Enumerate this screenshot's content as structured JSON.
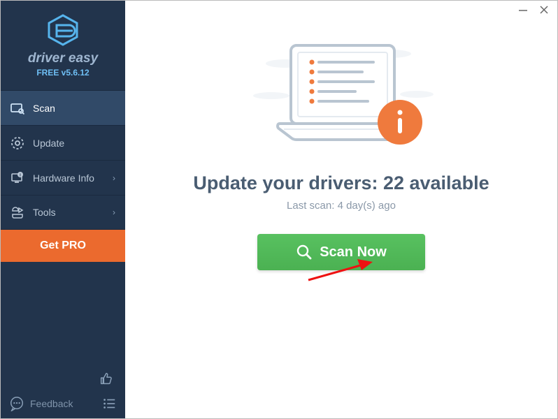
{
  "brand": {
    "name": "driver easy",
    "version": "FREE v5.6.12"
  },
  "sidebar": {
    "items": [
      {
        "label": "Scan"
      },
      {
        "label": "Update"
      },
      {
        "label": "Hardware Info"
      },
      {
        "label": "Tools"
      }
    ],
    "getpro_label": "Get PRO",
    "feedback_label": "Feedback"
  },
  "main": {
    "headline": "Update your drivers: 22 available",
    "subline": "Last scan: 4 day(s) ago",
    "scan_label": "Scan Now"
  },
  "colors": {
    "accent": "#eb6a2e",
    "green": "#4bb152",
    "sidebar": "#22344c",
    "info": "#ef7a3d"
  }
}
